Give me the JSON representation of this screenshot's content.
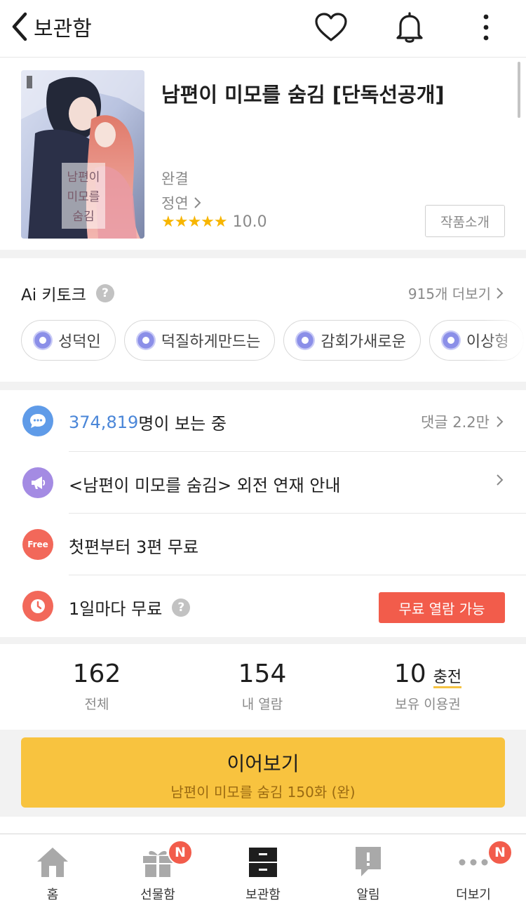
{
  "header": {
    "back_label": "보관함"
  },
  "book": {
    "title": "남편이 미모를 숨김 [단독선공개]",
    "status": "완결",
    "author": "정연",
    "stars": "★★★★★",
    "rating": "10.0",
    "rating_value": 10.0,
    "intro_button": "작품소개",
    "cover_lettering": [
      "남편이",
      "미모를",
      "숨김"
    ]
  },
  "keytalk": {
    "title": "Ai 키토크",
    "help": "?",
    "more": "915개 더보기",
    "chips": [
      "성덕인",
      "덕질하게만드는",
      "감회가새로운",
      "이상형"
    ]
  },
  "notices": {
    "viewers_count": "374,819",
    "viewers_suffix": "명이 보는 중",
    "comments": "댓글 2.2만",
    "announcement": "<남편이 미모를 숨김> 외전 연재 안내",
    "free_icon": "Free",
    "free_text": "첫편부터 3편 무료",
    "daily_text": "1일마다 무료",
    "daily_help": "?",
    "daily_button": "무료 열람 가능"
  },
  "counts": {
    "total": "162",
    "total_label": "전체",
    "read": "154",
    "read_label": "내 열람",
    "tickets": "10",
    "charge": "충전",
    "tickets_label": "보유 이용권"
  },
  "continue": {
    "main": "이어보기",
    "sub": "남편이 미모를 숨김 150화 (완)"
  },
  "tabbar": {
    "home": "홈",
    "gift": "선물함",
    "gift_badge": "N",
    "library": "보관함",
    "alarm": "알림",
    "more": "더보기",
    "more_badge": "N"
  },
  "colors": {
    "accent_yellow": "#f8c33f",
    "accent_red": "#f25c4b",
    "link_blue": "#4a86d8",
    "star": "#f7b500"
  },
  "icons": [
    "back-chevron-icon",
    "heart-icon",
    "bell-icon",
    "kebab-menu-icon",
    "chat-bubble-icon",
    "megaphone-icon",
    "free-icon",
    "clock-icon",
    "home-icon",
    "gift-icon",
    "library-icon",
    "alarm-icon",
    "more-dots-icon"
  ]
}
